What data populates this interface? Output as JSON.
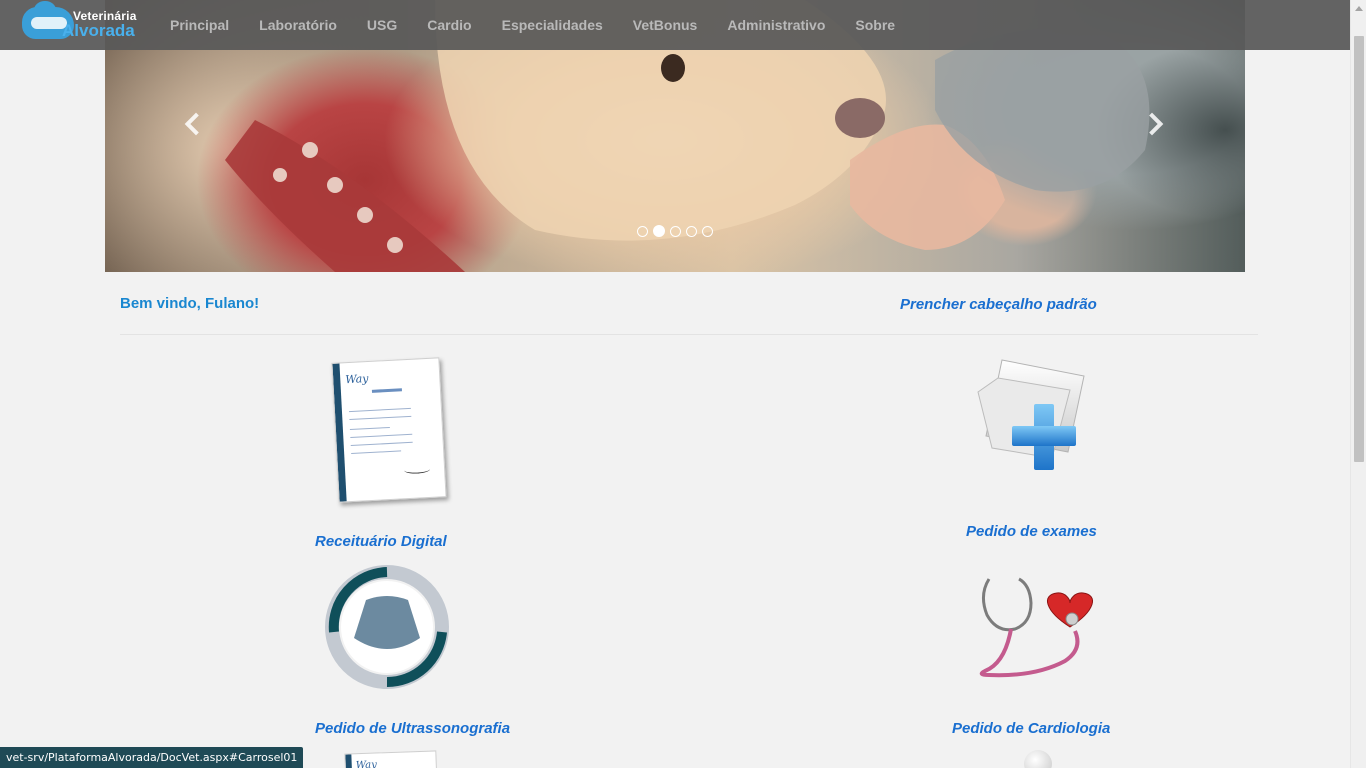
{
  "brand": {
    "line1": "Veterinária",
    "line2": "Alvorada"
  },
  "nav": {
    "items": [
      {
        "label": "Principal"
      },
      {
        "label": "Laboratório"
      },
      {
        "label": "USG"
      },
      {
        "label": "Cardio"
      },
      {
        "label": "Especialidades"
      },
      {
        "label": "VetBonus"
      },
      {
        "label": "Administrativo"
      },
      {
        "label": "Sobre"
      }
    ]
  },
  "carousel": {
    "prev_icon": "chevron-left-icon",
    "next_icon": "chevron-right-icon",
    "indicator_count": 5,
    "active_index": 1
  },
  "welcome": {
    "text": "Bem vindo, Fulano!",
    "header_link": "Prencher cabeçalho padrão"
  },
  "tiles": {
    "prescription": {
      "label": "Receituário Digital",
      "paper_logo": "Way"
    },
    "exams": {
      "label": "Pedido de exames"
    },
    "ultrasound": {
      "label": "Pedido de Ultrassonografia"
    },
    "cardiology": {
      "label": "Pedido de Cardiologia"
    }
  },
  "statusbar": {
    "url": "vet-srv/PlataformaAlvorada/DocVet.aspx#Carrosel01"
  },
  "colors": {
    "navbar": "#585858",
    "link": "#1a6fd0",
    "welcome": "#1a87d0",
    "brand_accent": "#49b0ec"
  }
}
